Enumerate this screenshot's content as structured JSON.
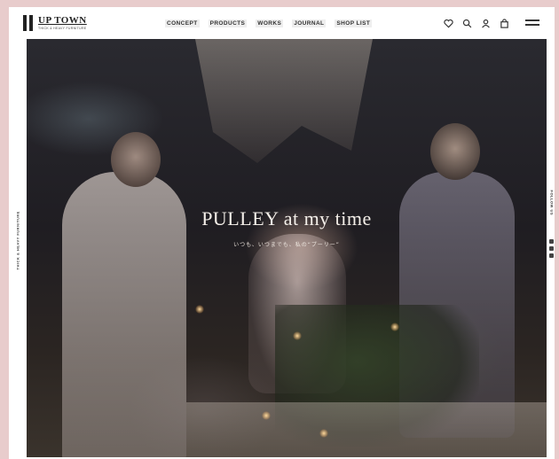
{
  "brand": {
    "name": "UP TOWN",
    "tagline": "THICK & HEAVY FURNITURE"
  },
  "nav": {
    "items": [
      {
        "label": "CONCEPT"
      },
      {
        "label": "PRODUCTS"
      },
      {
        "label": "WORKS"
      },
      {
        "label": "JOURNAL"
      },
      {
        "label": "SHOP LIST"
      }
    ]
  },
  "header_icons": [
    "heart-icon",
    "search-icon",
    "user-icon",
    "bag-icon",
    "menu-icon"
  ],
  "hero": {
    "title": "PULLEY at my time",
    "subtitle": "いつも、いつまでも、私の“プーリー”"
  },
  "side": {
    "left_text": "THICK & HEAVY FURNITURE",
    "right_text": "FOLLOW US"
  },
  "colors": {
    "frame": "#e8cccc",
    "header_bg": "#ffffff",
    "text_dark": "#222222",
    "hero_text": "#f4efe9"
  }
}
